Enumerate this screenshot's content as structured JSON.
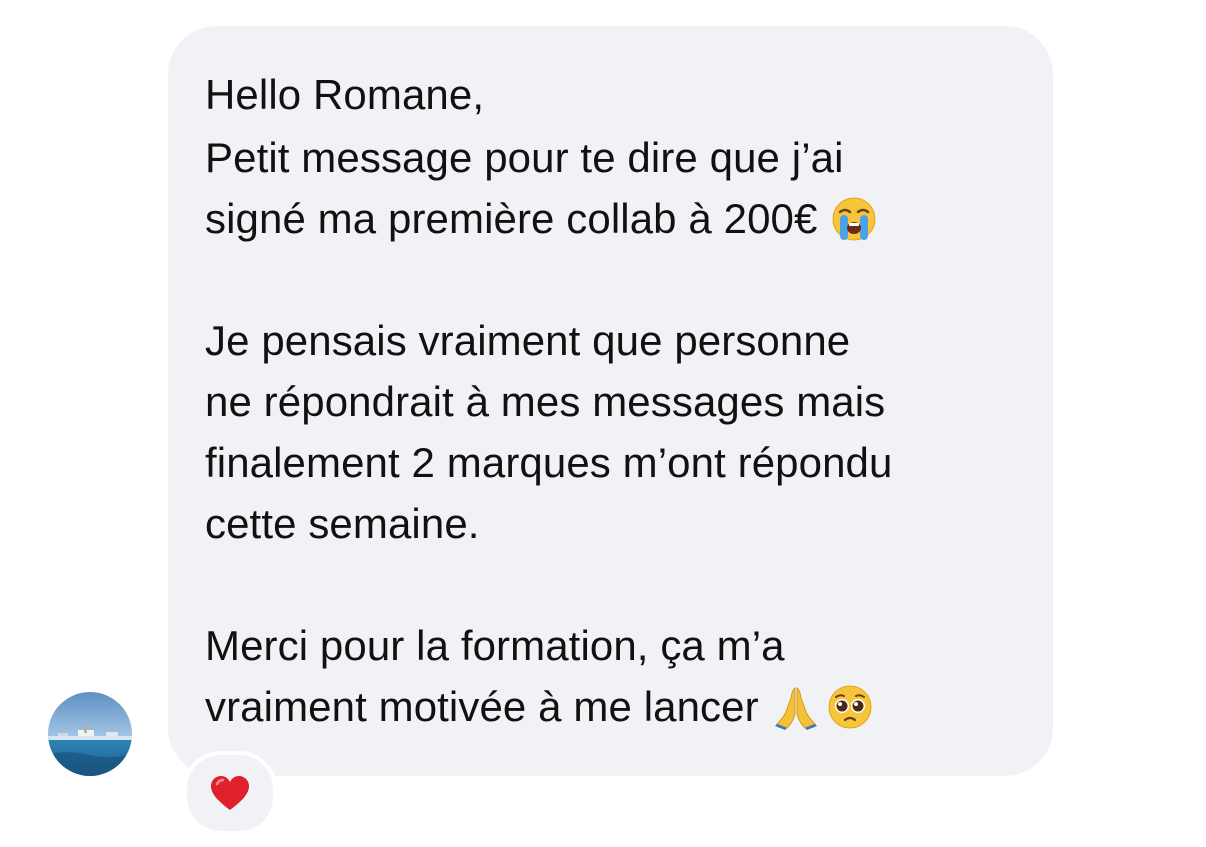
{
  "message": {
    "greeting": "Hello Romane,",
    "paragraph1_line1": "Petit message pour te dire que j’ai",
    "paragraph1_line2": "signé ma première collab à 200€",
    "paragraph2_line1": "Je pensais vraiment que personne",
    "paragraph2_line2": "ne répondrait à mes messages mais",
    "paragraph2_line3": "finalement 2 marques m’ont répondu",
    "paragraph2_line4": "cette semaine.",
    "paragraph3_line1": "Merci pour la formation, ça m’a",
    "paragraph3_line2": "vraiment motivée à me lancer"
  },
  "icons": {
    "line3_emoji": "loudly-crying-face-icon",
    "last_line_emojis": [
      "folded-hands-icon",
      "pleading-face-icon"
    ],
    "reaction": "red-heart-icon",
    "avatar": "sender-avatar"
  },
  "colors": {
    "bubble_background": "#f1f2f5",
    "text": "#111111",
    "heart": "#e0202c"
  }
}
